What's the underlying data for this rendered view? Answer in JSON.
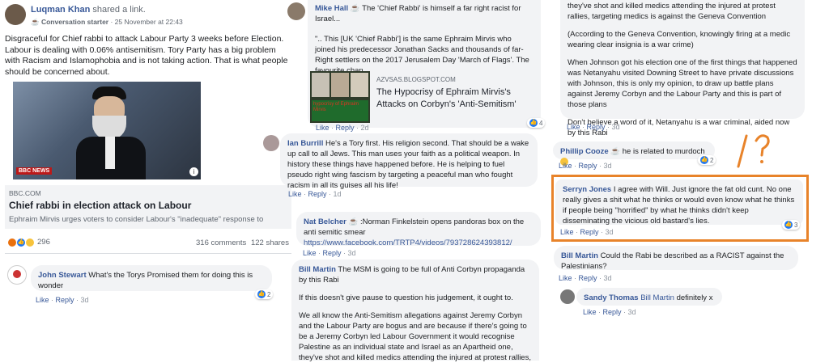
{
  "post": {
    "author": "Luqman Khan",
    "action": "shared a link.",
    "badge": "Conversation starter",
    "timestamp": "· 25 November at 22:43",
    "text": "Disgraceful for Chief rabbi to attack Labour Party 3 weeks before Election. Labour is dealing with 0.06% antisemitism. Tory Party has a big problem with Racism and Islamophobia and is not taking action. That is what people should be concerned about.",
    "image_logo": "BBC NEWS",
    "link_domain": "BBC.COM",
    "link_title": "Chief rabbi in election attack on Labour",
    "link_desc": "Ephraim Mirvis urges voters to consider Labour's \"inadequate\" response to",
    "reaction_count": "296",
    "comments_count": "316 comments",
    "shares_count": "122 shares"
  },
  "comments": {
    "john": {
      "author": "John Stewart",
      "text": "What's the Torys Promised them for doing this is wonder",
      "like": "Like",
      "reply": "Reply",
      "time": "3d",
      "reacts": "2"
    },
    "mike": {
      "author": "Mike Hall",
      "text": "The 'Chief Rabbi' is himself a far right racist for Israel...",
      "quote": "\".. This [UK 'Chief Rabbi'] is the same Ephraim Mirvis who joined his predecessor Jonathan Sacks and thousands of far-Right settlers on the 2017 Jerusalem Day 'March of Flags'. The favourite chan...",
      "see_more": "See more",
      "link_domain": "AZVSAS.BLOGSPOT.COM",
      "link_title": "The Hypocrisy of Ephraim Mirvis's Attacks on Corbyn's 'Anti-Semitism'",
      "like": "Like",
      "reply": "Reply",
      "time": "2d",
      "reacts": "4"
    },
    "ian": {
      "author": "Ian Burrill",
      "text": "He's a Tory first. His religion second. That should be a wake up call to all Jews. This man uses your faith as a political weapon. In history these things have happened before. He is helping to fuel pseudo right wing fascism by targeting a peaceful man who fought racism in all its guises all his life!",
      "like": "Like",
      "reply": "Reply",
      "time": "1d"
    },
    "nat": {
      "author": "Nat Belcher",
      "text": ":Norman Finkelstein opens pandoras box on the anti semitic smear",
      "link": "https://www.facebook.com/TRTP4/videos/793728624393812/",
      "like": "Like",
      "reply": "Reply",
      "time": "3d"
    },
    "bill_long": {
      "author": "Bill Martin",
      "p1": "The MSM is going to be full of Anti Corbyn propaganda by this Rabi",
      "p2": "If this doesn't give pause to question his judgement, it ought to.",
      "p3": "We all know the Anti-Semitism allegations against Jeremy Corbyn and the Labour Party are bogus and are because if there's going to be a Jeremy Corbyn led Labour Government it would recognise Palestine as an individual state and Israel as an Apartheid one, they've shot and killed medics attending the injured at protest rallies,"
    },
    "bill_cont": {
      "p1": "they've shot and killed medics attending the injured at protest rallies, targeting medics is against the Geneva Convention",
      "p2": "(According to the Geneva Convention, knowingly firing at a medic wearing clear insignia is a war crime)",
      "p3": "When Johnson got his election one of the first things that happened was Netanyahu visited Downing Street to have private discussions with Johnson, this is only my opinion, to draw up battle plans against Jeremy Corbyn and the Labour Party and this is part of those plans",
      "p4": "Don't believe a word of it, Netanyahu is a war criminal, aided now by this Rabi",
      "like": "Like",
      "reply": "Reply",
      "time": "3d"
    },
    "phillip": {
      "author": "Phillip Cooze",
      "text": "he is related to murdoch",
      "like": "Like",
      "reply": "Reply",
      "time": "3d",
      "reacts": "2"
    },
    "serryn": {
      "author": "Serryn Jones",
      "text": "I agree with Will. Just ignore the fat old cunt. No one really gives a shit what he thinks or would even know what he thinks if people being \"horrified\" by what he thinks didn't keep disseminating the vicious old bastard's lies.",
      "like": "Like",
      "reply": "Reply",
      "time": "3d",
      "reacts": "3"
    },
    "bill_short": {
      "author": "Bill Martin",
      "text": "Could the Rabi be described as a RACIST against the Palestinians?",
      "like": "Like",
      "reply": "Reply",
      "time": "3d"
    },
    "sandy": {
      "author": "Sandy Thomas",
      "mention": "Bill Martin",
      "text": "definitely x",
      "like": "Like",
      "reply": "Reply",
      "time": "3d"
    }
  },
  "annotation": {
    "marks": "/ ?",
    "color": "#e8832a"
  },
  "colors": {
    "author": "#385898",
    "bubble": "#f2f3f5",
    "highlight": "#e8832a",
    "meta": "#8d949e"
  }
}
